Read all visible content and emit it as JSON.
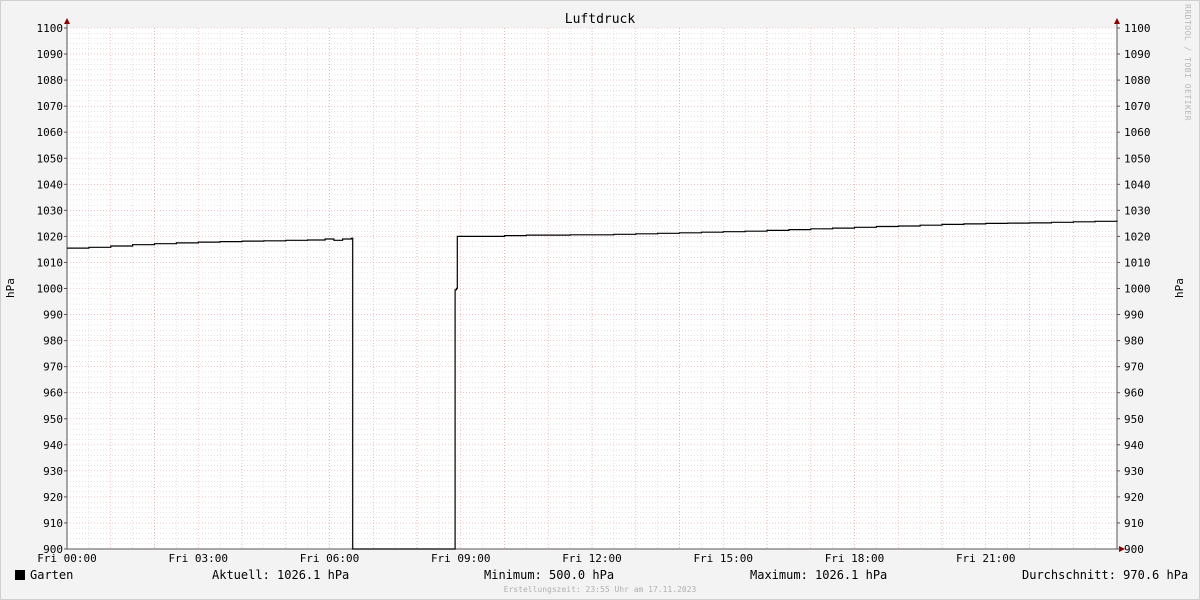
{
  "chart_data": {
    "type": "line",
    "title": "Luftdruck",
    "ylabel_left": "hPa",
    "ylabel_right": "hPa",
    "ylim": [
      900,
      1100
    ],
    "yticks": [
      900,
      910,
      920,
      930,
      940,
      950,
      960,
      970,
      980,
      990,
      1000,
      1010,
      1020,
      1030,
      1040,
      1050,
      1060,
      1070,
      1080,
      1090,
      1100
    ],
    "xlim_hours": [
      0,
      24
    ],
    "xticks": [
      {
        "hour": 0,
        "label": "Fri 00:00"
      },
      {
        "hour": 3,
        "label": "Fri 03:00"
      },
      {
        "hour": 6,
        "label": "Fri 06:00"
      },
      {
        "hour": 9,
        "label": "Fri 09:00"
      },
      {
        "hour": 12,
        "label": "Fri 12:00"
      },
      {
        "hour": 15,
        "label": "Fri 15:00"
      },
      {
        "hour": 18,
        "label": "Fri 18:00"
      },
      {
        "hour": 21,
        "label": "Fri 21:00"
      }
    ],
    "grid": true,
    "series": [
      {
        "name": "Garten",
        "color": "#000000",
        "x_hours": [
          0.0,
          0.5,
          1.0,
          1.5,
          2.0,
          2.5,
          3.0,
          3.5,
          4.0,
          4.5,
          5.0,
          5.5,
          5.9,
          6.1,
          6.3,
          6.5,
          6.52,
          6.53,
          8.85,
          8.87,
          8.9,
          8.92,
          9.5,
          10.0,
          10.5,
          11.0,
          11.5,
          12.0,
          12.5,
          13.0,
          13.5,
          14.0,
          14.5,
          15.0,
          15.5,
          16.0,
          16.5,
          17.0,
          17.5,
          18.0,
          18.5,
          19.0,
          19.5,
          20.0,
          20.5,
          21.0,
          21.5,
          22.0,
          22.5,
          23.0,
          23.5,
          24.0
        ],
        "values": [
          1015.5,
          1015.8,
          1016.3,
          1016.8,
          1017.2,
          1017.5,
          1017.8,
          1018.0,
          1018.2,
          1018.3,
          1018.5,
          1018.6,
          1019.0,
          1018.5,
          1019.0,
          1019.3,
          1019.3,
          900,
          900,
          999.5,
          1000,
          1020.0,
          1020.0,
          1020.3,
          1020.5,
          1020.5,
          1020.6,
          1020.6,
          1020.8,
          1021.0,
          1021.2,
          1021.4,
          1021.6,
          1021.8,
          1022.0,
          1022.3,
          1022.6,
          1022.9,
          1023.2,
          1023.5,
          1023.8,
          1024.0,
          1024.3,
          1024.6,
          1024.8,
          1025.0,
          1025.1,
          1025.2,
          1025.4,
          1025.6,
          1025.8,
          1026.1
        ]
      }
    ]
  },
  "legend": {
    "series_name": "Garten",
    "current": "Aktuell: 1026.1 hPa",
    "minimum": "Minimum: 500.0 hPa",
    "maximum": "Maximum: 1026.1 hPa",
    "average": "Durchschnitt: 970.6 hPa"
  },
  "footer": "Erstellungszeit: 23:55 Uhr am 17.11.2023",
  "watermark": "RRDTOOL / TOBI OETIKER",
  "colors": {
    "major_grid": "#e6a0a0",
    "minor_grid": "#c8c8c8",
    "axis": "#555555",
    "arrow": "#8b0000",
    "plot_bg": "#ffffff"
  }
}
